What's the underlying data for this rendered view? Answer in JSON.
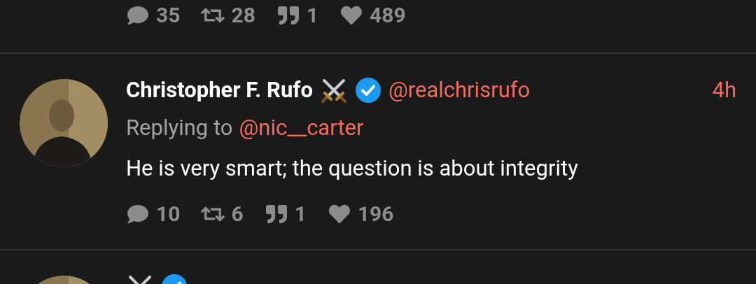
{
  "previous_tweet": {
    "stats": {
      "replies": "35",
      "retweets": "28",
      "quotes": "1",
      "likes": "489"
    }
  },
  "tweets": [
    {
      "name": "Christopher F. Rufo",
      "verified": true,
      "handle": "@realchrisrufo",
      "time": "4h",
      "replying_label": "Replying to",
      "replying_to": "@nic__carter",
      "text": "He is very smart; the question is about integrity",
      "stats": {
        "replies": "10",
        "retweets": "6",
        "quotes": "1",
        "likes": "196"
      }
    },
    {
      "verified": true
    }
  ]
}
